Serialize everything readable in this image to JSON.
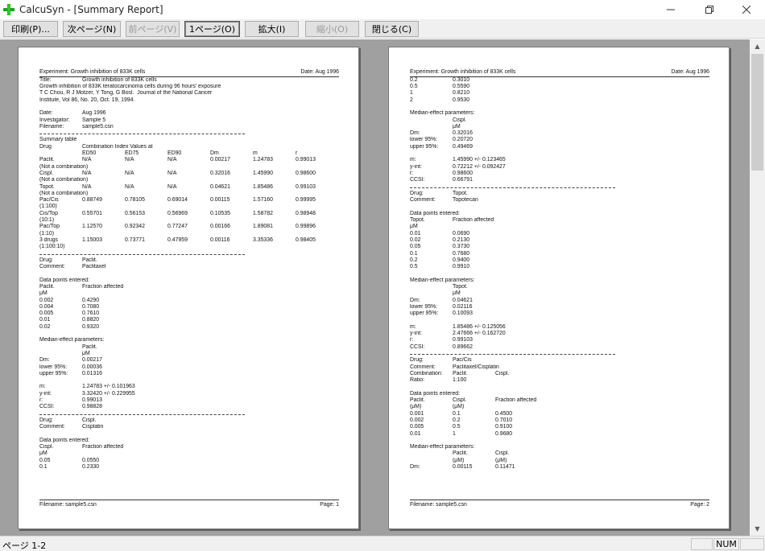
{
  "window": {
    "title": "CalcuSyn - [Summary Report]"
  },
  "toolbar": {
    "buttons": [
      {
        "label": "印刷(P)...",
        "state": "normal"
      },
      {
        "label": "次ページ(N)",
        "state": "normal"
      },
      {
        "label": "前ページ(V)",
        "state": "disabled"
      },
      {
        "label": "1ページ(O)",
        "state": "active"
      },
      {
        "label": "拡大(I)",
        "state": "normal"
      },
      {
        "label": "縮小(O)",
        "state": "disabled"
      },
      {
        "label": "閉じる(C)",
        "state": "normal"
      }
    ]
  },
  "pages": [
    {
      "header_left": "Experiment: Growth inhibition of 833K cells",
      "header_right": "Date: Aug 1996",
      "footer_left": "Filename: sample5.csn",
      "footer_right": "Page: 1",
      "lines": [
        [
          "Title:",
          "Growth inhibition of 833K cells"
        ],
        [
          "Growth inhibition of 833K teratocarcinoma cells during 96 hours' exposure"
        ],
        [
          "T C Chou, R J Motzer, Y Tong, G Bosl.  Journal of the National Cancer"
        ],
        [
          "Institute, Vol 86, No. 20, Oct. 19, 1994."
        ],
        [
          ""
        ],
        [
          "Date:",
          "Aug 1996"
        ],
        [
          "Investigator:",
          "Sample 5"
        ],
        [
          "Filename:",
          "sample5.csn"
        ],
        [
          "---"
        ],
        [
          "Summary table"
        ],
        [
          "Drug",
          "Combination Index Values at"
        ],
        [
          "",
          "ED50",
          "ED75",
          "ED90",
          "Dm",
          "m",
          "r"
        ],
        [
          "Paclit.",
          "N/A",
          "N/A",
          "N/A",
          "0.00217",
          "1.24783",
          "0.99013"
        ],
        [
          "(Not a combination)"
        ],
        [
          "Cispl.",
          "N/A",
          "N/A",
          "N/A",
          "0.32016",
          "1.45990",
          "0.98600"
        ],
        [
          "(Not a combination)"
        ],
        [
          "Topot.",
          "N/A",
          "N/A",
          "N/A",
          "0.04621",
          "1.85486",
          "0.99103"
        ],
        [
          "(Not a combination)"
        ],
        [
          "Pac/Cis",
          "0.88749",
          "0.78105",
          "0.69014",
          "0.00115",
          "1.57160",
          "0.99995"
        ],
        [
          "(1:100)"
        ],
        [
          "Cis/Top",
          "0.55701",
          "0.56153",
          "0.56969",
          "0.10535",
          "1.58782",
          "0.98948"
        ],
        [
          "(10:1)"
        ],
        [
          "Pac/Top",
          "1.12570",
          "0.92342",
          "0.77247",
          "0.00166",
          "1.89081",
          "0.99896"
        ],
        [
          "(1:10)"
        ],
        [
          "3 drugs",
          "1.15003",
          "0.73771",
          "0.47959",
          "0.00116",
          "3.35336",
          "0.98405"
        ],
        [
          "(1:100:10)"
        ],
        [
          "---"
        ],
        [
          "Drug:",
          "Paclit."
        ],
        [
          "Comment:",
          "Paclitaxel"
        ],
        [
          ""
        ],
        [
          "Data points entered:"
        ],
        [
          "Paclit.",
          "Fraction affected"
        ],
        [
          "μM"
        ],
        [
          "0.002",
          "0.4290"
        ],
        [
          "0.004",
          "0.7080"
        ],
        [
          "0.005",
          "0.7610"
        ],
        [
          "0.01",
          "0.8820"
        ],
        [
          "0.02",
          "0.9320"
        ],
        [
          ""
        ],
        [
          "Median-effect parameters:"
        ],
        [
          "",
          "Paclit."
        ],
        [
          "",
          "μM"
        ],
        [
          "Dm:",
          "0.00217"
        ],
        [
          "lower 95%:",
          "0.00036"
        ],
        [
          "upper 95%:",
          "0.01316"
        ],
        [
          ""
        ],
        [
          "m:",
          "1.24783 +/- 0.101963"
        ],
        [
          "y-int:",
          "3.32420 +/- 0.229955"
        ],
        [
          "r:",
          "0.99013"
        ],
        [
          "CCSI:",
          "0.98828"
        ],
        [
          "---"
        ],
        [
          "Drug:",
          "Cispl."
        ],
        [
          "Comment:",
          "Cisplatin"
        ],
        [
          ""
        ],
        [
          "Data points entered:"
        ],
        [
          "Cispl.",
          "Fraction affected"
        ],
        [
          "μM"
        ],
        [
          "0.05",
          "0.0550"
        ],
        [
          "0.1",
          "0.2330"
        ]
      ]
    },
    {
      "header_left": "Experiment: Growth inhibition of 833K cells",
      "header_right": "Date: Aug 1996",
      "footer_left": "Filename: sample5.csn",
      "footer_right": "Page: 2",
      "lines": [
        [
          "0.2",
          "0.3010"
        ],
        [
          "0.5",
          "0.5590"
        ],
        [
          "1",
          "0.8210"
        ],
        [
          "2",
          "0.9530"
        ],
        [
          ""
        ],
        [
          "Median-effect parameters:"
        ],
        [
          "",
          "Cispl."
        ],
        [
          "",
          "μM"
        ],
        [
          "Dm:",
          "0.32016"
        ],
        [
          "lower 95%:",
          "0.20720"
        ],
        [
          "upper 95%:",
          "0.49469"
        ],
        [
          ""
        ],
        [
          "m:",
          "1.45990 +/- 0.123465"
        ],
        [
          "y-int:",
          "0.72212 +/- 0.092427"
        ],
        [
          "r:",
          "0.98600"
        ],
        [
          "CCSI:",
          "0.66791"
        ],
        [
          "---"
        ],
        [
          "Drug:",
          "Topot."
        ],
        [
          "Comment:",
          "Topotecan"
        ],
        [
          ""
        ],
        [
          "Data points entered:"
        ],
        [
          "Topot.",
          "Fraction affected"
        ],
        [
          "μM"
        ],
        [
          "0.01",
          "0.0690"
        ],
        [
          "0.02",
          "0.2130"
        ],
        [
          "0.05",
          "0.3730"
        ],
        [
          "0.1",
          "0.7680"
        ],
        [
          "0.2",
          "0.9400"
        ],
        [
          "0.5",
          "0.9910"
        ],
        [
          ""
        ],
        [
          "Median-effect parameters:"
        ],
        [
          "",
          "Topot."
        ],
        [
          "",
          "μM"
        ],
        [
          "Dm:",
          "0.04621"
        ],
        [
          "lower 95%:",
          "0.02116"
        ],
        [
          "upper 95%:",
          "0.10093"
        ],
        [
          ""
        ],
        [
          "m:",
          "1.85486 +/- 0.125056"
        ],
        [
          "y-int:",
          "2.47666 +/- 0.162720"
        ],
        [
          "r:",
          "0.99103"
        ],
        [
          "CCSI:",
          "0.89662"
        ],
        [
          "---"
        ],
        [
          "Drug:",
          "Pac/Cis"
        ],
        [
          "Comment:",
          "Paclitaxel/Cisplatin"
        ],
        [
          "Combination:",
          "Paclit.",
          "Cispl."
        ],
        [
          "Ratio:",
          "1:100"
        ],
        [
          ""
        ],
        [
          "Data points entered:"
        ],
        [
          "Paclit.",
          "Cispl.",
          "Fraction affected"
        ],
        [
          "(μM)",
          "(μM)"
        ],
        [
          "0.001",
          "0.1",
          "0.4500"
        ],
        [
          "0.002",
          "0.2",
          "0.7010"
        ],
        [
          "0.005",
          "0.5",
          "0.9100"
        ],
        [
          "0.01",
          "1",
          "0.9680"
        ],
        [
          ""
        ],
        [
          "Median-effect parameters:"
        ],
        [
          "",
          "Paclit.",
          "Cispl."
        ],
        [
          "",
          "(μM)",
          "(μM)"
        ],
        [
          "Dm:",
          "0.00115",
          "0.11471"
        ]
      ]
    }
  ],
  "statusbar": {
    "text": "ページ 1-2",
    "num": "NUM"
  }
}
